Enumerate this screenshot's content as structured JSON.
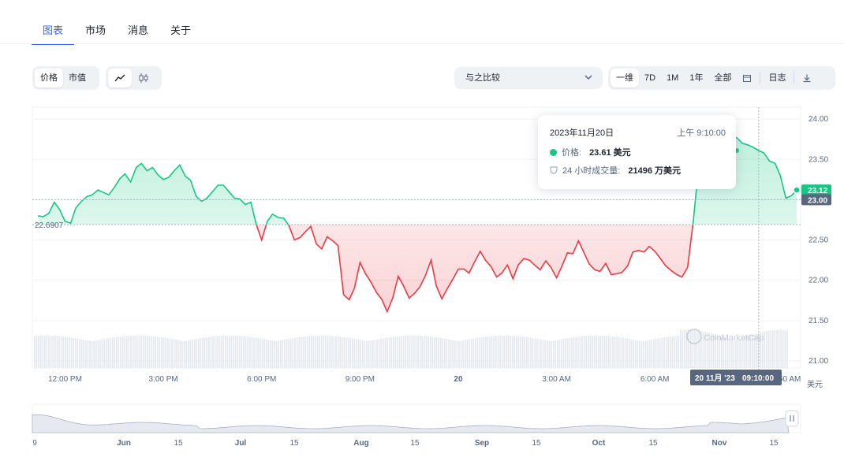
{
  "tabs": [
    {
      "label": "图表",
      "active": true
    },
    {
      "label": "市场",
      "active": false
    },
    {
      "label": "消息",
      "active": false
    },
    {
      "label": "关于",
      "active": false
    }
  ],
  "toolbar": {
    "price_label": "价格",
    "mcap_label": "市值",
    "line_icon": "line-chart-icon",
    "candle_icon": "candlestick-icon",
    "compare_label": "与之比较",
    "ranges": [
      "一维",
      "7D",
      "1M",
      "1年",
      "全部"
    ],
    "active_range": "一维",
    "calendar_icon": "calendar-icon",
    "log_label": "日志",
    "download_icon": "download-icon"
  },
  "tooltip": {
    "date": "2023年11月20日",
    "time": "上午 9:10:00",
    "price_label": "价格:",
    "price_value": "23.61 美元",
    "volume_label": "24 小时成交量:",
    "volume_value": "21496 万美元"
  },
  "chart_data": {
    "type": "line",
    "reference_value": 22.6907,
    "reference_label": "22.6907",
    "current_price_label": "23.12",
    "crosshair_price_label": "23.00",
    "crosshair_time_label_date": "20 11月 '23",
    "crosshair_time_label_time": "09:10:00",
    "y_unit": "美元",
    "y_ticks": [
      "24.00",
      "23.50",
      "23.00",
      "22.50",
      "22.00",
      "21.50",
      "21.00"
    ],
    "ylim": [
      21.0,
      24.0
    ],
    "x_ticks": [
      "12:00 PM",
      "3:00 PM",
      "6:00 PM",
      "9:00 PM",
      "20",
      "3:00 AM",
      "6:00 AM"
    ],
    "x_tick_hours": [
      12,
      15,
      18,
      21,
      24,
      27,
      30
    ],
    "x_cut_label": "50 AM",
    "xlim_hours": [
      11.0,
      34.45
    ],
    "crosshair_hour": 33.17,
    "watermark": "CoinMarketCap",
    "series": [
      {
        "x": [
          11.17,
          11.33,
          11.5,
          11.67,
          11.83,
          12.0,
          12.17,
          12.33,
          12.5,
          12.67,
          12.83,
          13.0,
          13.17,
          13.33,
          13.5,
          13.67,
          13.83,
          14.0,
          14.17,
          14.33,
          14.5,
          14.67,
          14.83,
          15.0,
          15.17,
          15.33,
          15.5,
          15.67,
          15.83,
          16.0,
          16.17,
          16.33,
          16.5,
          16.67,
          16.83,
          17.0,
          17.17,
          17.33,
          17.5,
          17.67,
          17.83,
          18.0,
          18.17,
          18.33,
          18.5,
          18.67,
          18.83,
          19.0,
          19.17,
          19.33,
          19.5,
          19.67,
          19.83,
          20.0,
          20.17,
          20.33,
          20.5,
          20.67,
          20.83,
          21.0,
          21.17,
          21.33,
          21.5,
          21.67,
          21.83,
          22.0,
          22.17,
          22.33,
          22.5,
          22.67,
          22.83,
          23.0,
          23.17,
          23.33,
          23.5,
          23.67,
          23.83,
          24.0,
          24.17,
          24.33,
          24.5,
          24.67,
          24.83,
          25.0,
          25.17,
          25.33,
          25.5,
          25.67,
          25.83,
          26.0,
          26.17,
          26.33,
          26.5,
          26.67,
          26.83,
          27.0,
          27.17,
          27.33,
          27.5,
          27.67,
          27.83,
          28.0,
          28.17,
          28.33,
          28.5,
          28.67,
          28.83,
          29.0,
          29.17,
          29.33,
          29.5,
          29.67,
          29.83,
          30.0,
          30.17,
          30.33,
          30.5,
          30.67,
          30.83,
          31.0,
          31.17,
          31.33,
          31.5,
          31.67,
          31.83,
          32.0,
          32.17,
          32.33,
          32.5,
          32.67,
          32.83,
          33.0,
          33.17,
          33.33,
          33.5,
          33.67,
          33.83,
          34.0,
          34.17,
          34.33
        ],
        "y": [
          22.8,
          22.79,
          22.83,
          22.97,
          22.88,
          22.73,
          22.71,
          22.9,
          22.98,
          23.04,
          23.06,
          23.12,
          23.09,
          23.06,
          23.15,
          23.26,
          23.32,
          23.22,
          23.4,
          23.45,
          23.36,
          23.4,
          23.31,
          23.25,
          23.28,
          23.36,
          23.43,
          23.29,
          23.24,
          23.04,
          22.98,
          23.02,
          23.1,
          23.18,
          23.18,
          23.1,
          23.02,
          23.01,
          22.94,
          22.97,
          22.7,
          22.5,
          22.73,
          22.82,
          22.78,
          22.77,
          22.68,
          22.5,
          22.53,
          22.6,
          22.67,
          22.45,
          22.39,
          22.54,
          22.49,
          22.43,
          21.82,
          21.76,
          21.9,
          22.22,
          22.08,
          21.98,
          21.85,
          21.76,
          21.61,
          21.78,
          22.05,
          21.93,
          21.78,
          21.84,
          21.92,
          22.06,
          22.25,
          21.93,
          21.77,
          21.9,
          22.01,
          22.14,
          22.14,
          22.09,
          22.23,
          22.36,
          22.25,
          22.17,
          22.04,
          22.09,
          22.19,
          22.02,
          22.19,
          22.27,
          22.25,
          22.19,
          22.13,
          22.24,
          22.16,
          22.03,
          22.18,
          22.34,
          22.33,
          22.49,
          22.35,
          22.2,
          22.13,
          22.11,
          22.21,
          22.07,
          22.08,
          22.1,
          22.18,
          22.35,
          22.37,
          22.35,
          22.42,
          22.36,
          22.27,
          22.18,
          22.12,
          22.07,
          22.04,
          22.16,
          22.72,
          23.38,
          23.71,
          23.75,
          23.83,
          23.84,
          23.79,
          23.76,
          23.77,
          23.7,
          23.68,
          23.65,
          23.61,
          23.58,
          23.48,
          23.45,
          23.3,
          23.02,
          23.05,
          23.12
        ]
      }
    ]
  },
  "navigator": {
    "labels": [
      "9",
      "Jun",
      "15",
      "Jul",
      "15",
      "Aug",
      "15",
      "Sep",
      "15",
      "Oct",
      "15",
      "Nov",
      "15"
    ],
    "handle_icon": "pause-handle-icon"
  }
}
